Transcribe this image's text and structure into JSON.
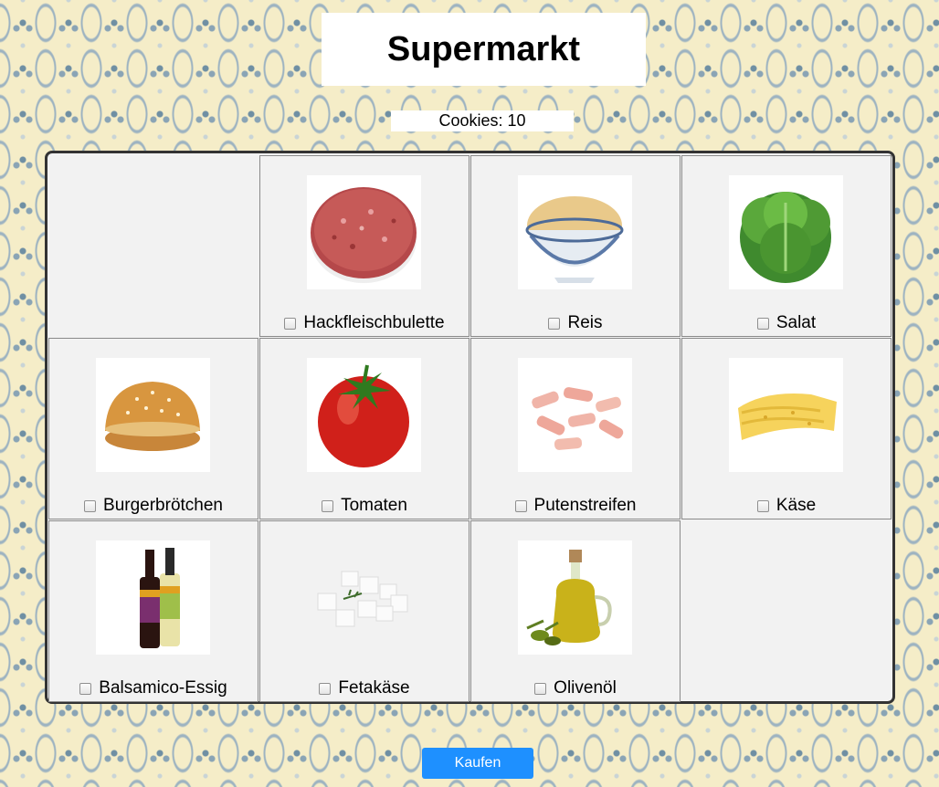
{
  "header": {
    "title": "Supermarkt"
  },
  "cookies": {
    "label": "Cookies: 10"
  },
  "products": [
    {
      "name": "Hackfleischbulette",
      "icon": "patty-icon",
      "checked": false
    },
    {
      "name": "Reis",
      "icon": "rice-bowl-icon",
      "checked": false
    },
    {
      "name": "Salat",
      "icon": "lettuce-icon",
      "checked": false
    },
    {
      "name": "Burgerbrötchen",
      "icon": "burger-bun-icon",
      "checked": false
    },
    {
      "name": "Tomaten",
      "icon": "tomato-icon",
      "checked": false
    },
    {
      "name": "Putenstreifen",
      "icon": "turkey-strips-icon",
      "checked": false
    },
    {
      "name": "Käse",
      "icon": "cheese-icon",
      "checked": false
    },
    {
      "name": "Balsamico-Essig",
      "icon": "vinegar-bottles-icon",
      "checked": false
    },
    {
      "name": "Fetakäse",
      "icon": "feta-icon",
      "checked": false
    },
    {
      "name": "Olivenöl",
      "icon": "olive-oil-icon",
      "checked": false
    }
  ],
  "actions": {
    "buy_label": "Kaufen"
  },
  "colors": {
    "button": "#1e90ff",
    "panel": "#f2f2f2",
    "background": "#f5edc8"
  }
}
